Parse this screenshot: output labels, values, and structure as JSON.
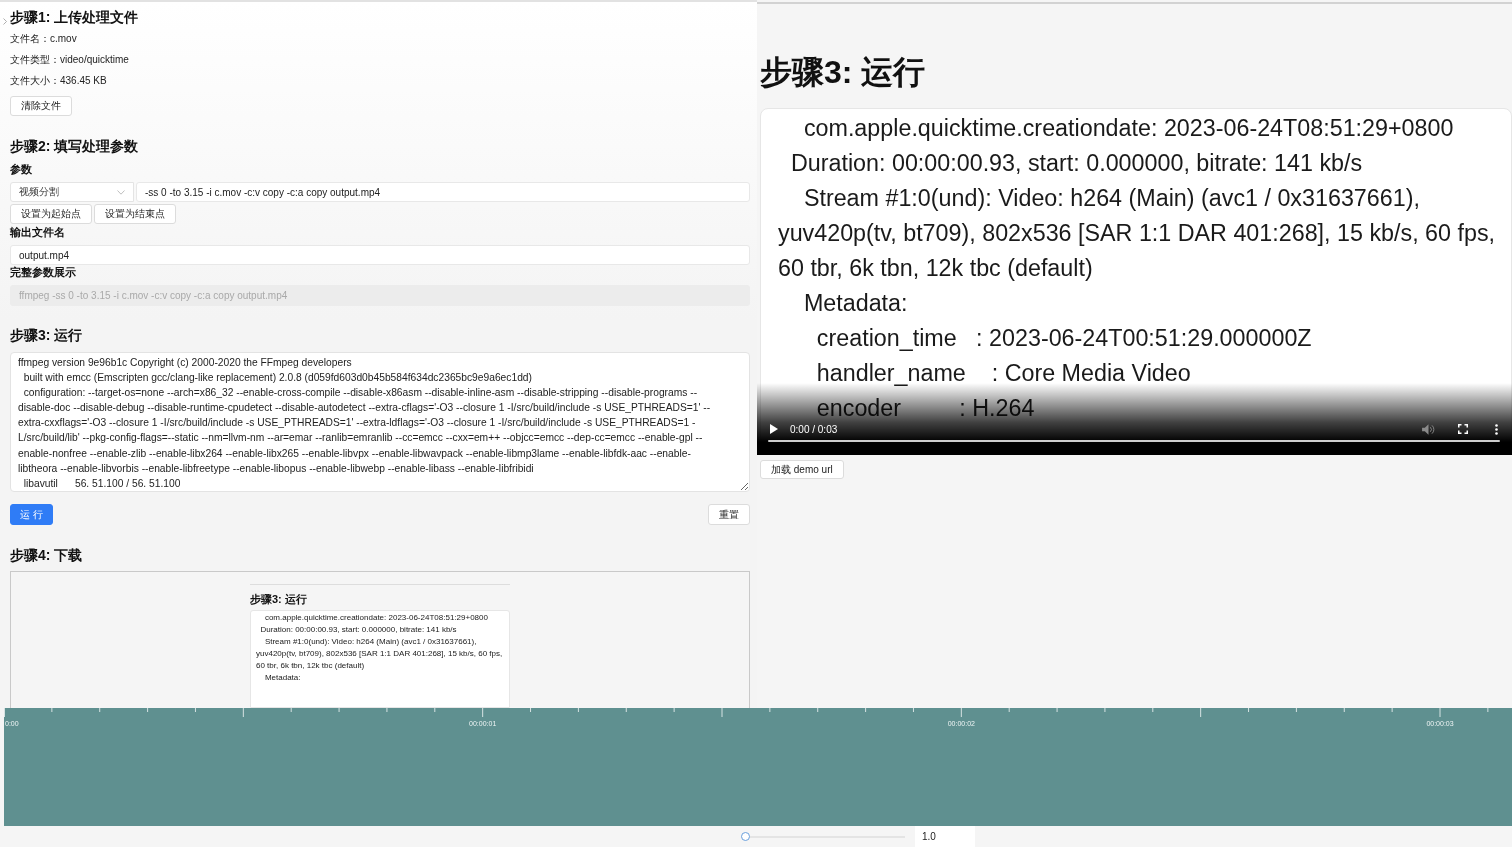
{
  "left_panel": {
    "step1": {
      "heading": "步骤1: 上传处理文件",
      "file_info": [
        "文件名：c.mov",
        "文件类型：video/quicktime",
        "文件大小：436.45 KB"
      ],
      "clear_button": "清除文件"
    },
    "step2": {
      "heading": "步骤2: 填写处理参数",
      "params_label": "参数",
      "preset_select": {
        "value": "视频分割"
      },
      "params_input": {
        "value": "-ss 0 -to 3.15 -i c.mov -c:v copy -c:a copy output.mp4"
      },
      "point_buttons": [
        "设置为起始点",
        "设置为结束点"
      ],
      "output_label": "输出文件名",
      "output_input": {
        "value": "output.mp4"
      },
      "full_label": "完整参数展示",
      "full_input": {
        "value": "ffmpeg -ss 0 -to 3.15 -i c.mov -c:v copy -c:a copy output.mp4",
        "disabled": true
      }
    },
    "step3": {
      "heading": "步骤3: 运行",
      "log_lines": [
        "ffmpeg version 9e96b1c Copyright (c) 2000-2020 the FFmpeg developers",
        "  built with emcc (Emscripten gcc/clang-like replacement) 2.0.8 (d059fd603d0b45b584f634dc2365bc9e9a6ec1dd)",
        "  configuration: --target-os=none --arch=x86_32 --enable-cross-compile --disable-x86asm --disable-inline-asm --disable-stripping --disable-programs --disable-doc --disable-debug --disable-runtime-cpudetect --disable-autodetect --extra-cflags='-O3 --closure 1 -I/src/build/include -s USE_PTHREADS=1' --extra-cxxflags='-O3 --closure 1 -I/src/build/include -s USE_PTHREADS=1' --extra-ldflags='-O3 --closure 1 -I/src/build/include -s USE_PTHREADS=1 -L/src/build/lib' --pkg-config-flags=--static --nm=llvm-nm --ar=emar --ranlib=emranlib --cc=emcc --cxx=em++ --objcc=emcc --dep-cc=emcc --enable-gpl --enable-nonfree --enable-zlib --enable-libx264 --enable-libx265 --enable-libvpx --enable-libwavpack --enable-libmp3lame --enable-libfdk-aac --enable-libtheora --enable-libvorbis --enable-libfreetype --enable-libopus --enable-libwebp --enable-libass --enable-libfribidi",
        "  libavutil      56. 51.100 / 56. 51.100"
      ],
      "buttons": [
        {
          "label": "运 行",
          "kind": "primary"
        },
        {
          "label": "重置",
          "kind": "default"
        }
      ]
    },
    "step4": {
      "heading": "步骤4: 下载",
      "preview_frame": {
        "heading": "步骤3: 运行",
        "lines": [
          "    com.apple.quicktime.creationdate: 2023-06-24T08:51:29+0800",
          "  Duration: 00:00:00.93, start: 0.000000, bitrate: 141 kb/s",
          "    Stream #1:0(und): Video: h264 (Main) (avc1 / 0x31637661), yuv420p(tv, bt709), 802x536 [SAR 1:1 DAR 401:268], 15 kb/s, 60 fps, 60 tbr, 6k tbn, 12k tbc (default)",
          "    Metadata:"
        ]
      }
    }
  },
  "video_player": {
    "frame": {
      "heading": "步骤3: 运行",
      "lines": [
        "    com.apple.quicktime.creationdate: 2023-06-24T08:51:29+0800",
        "  Duration: 00:00:00.93, start: 0.000000, bitrate: 141 kb/s",
        "    Stream #1:0(und): Video: h264 (Main) (avc1 / 0x31637661), yuv420p(tv, bt709), 802x536 [SAR 1:1 DAR 401:268], 15 kb/s, 60 fps, 60 tbr, 6k tbn, 12k tbc (default)",
        "    Metadata:",
        "      creation_time   : 2023-06-24T00:51:29.000000Z",
        "      handler_name    : Core Media Video",
        "      encoder         : H.264"
      ]
    },
    "time": "0:00 / 0:03"
  },
  "load_demo_button": "加载 demo url",
  "timeline": {
    "tick_labels": [
      "0:00",
      "00:00:01",
      "00:00:02",
      "00:00:03"
    ]
  },
  "zoom_control": {
    "level": 0,
    "value": "1.0"
  }
}
